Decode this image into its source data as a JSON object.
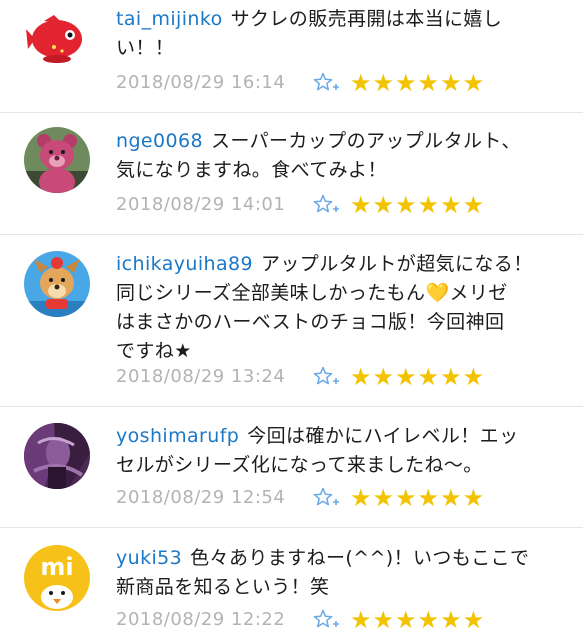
{
  "colors": {
    "username": "#1b78c7",
    "body_text": "#1c1c1c",
    "timestamp": "#b3b3b3",
    "star": "#f2c300",
    "fav_icon": "#6aa9e9",
    "divider": "#e6e6e6"
  },
  "icons": {
    "favorite": "star-plus-icon",
    "rating_star": "filled-star-icon"
  },
  "comments": [
    {
      "username": "tai_mijinko",
      "body_lines": [
        "サクレの販売再開は本当に嬉し",
        "い！！"
      ],
      "timestamp": "2018/08/29 16:14",
      "rating": 6,
      "avatar": "red-fish-avatar"
    },
    {
      "username": "nge0068",
      "body_lines": [
        "スーパーカップのアップルタルト、",
        "気になりますね。食べてみよ！"
      ],
      "timestamp": "2018/08/29 14:01",
      "rating": 6,
      "avatar": "pink-bear-avatar"
    },
    {
      "username": "ichikayuiha89",
      "body_lines": [
        "アップルタルトが超気になる！",
        "同じシリーズ全部美味しかったもん💛メリゼ",
        "はまさかのハーベストのチョコ版！今回神回",
        "ですね★"
      ],
      "timestamp": "2018/08/29 13:24",
      "rating": 6,
      "avatar": "dog-avatar"
    },
    {
      "username": "yoshimarufp",
      "body_lines": [
        "今回は確かにハイレベル！エッ",
        "セルがシリーズ化になって来ましたね〜。"
      ],
      "timestamp": "2018/08/29 12:54",
      "rating": 6,
      "avatar": "purple-photo-avatar"
    },
    {
      "username": "yuki53",
      "body_lines": [
        "色々ありますねー(^^)！いつもここで",
        "新商品を知るという！笑"
      ],
      "timestamp": "2018/08/29 12:22",
      "rating": 6,
      "avatar": "mi-duck-avatar"
    }
  ]
}
